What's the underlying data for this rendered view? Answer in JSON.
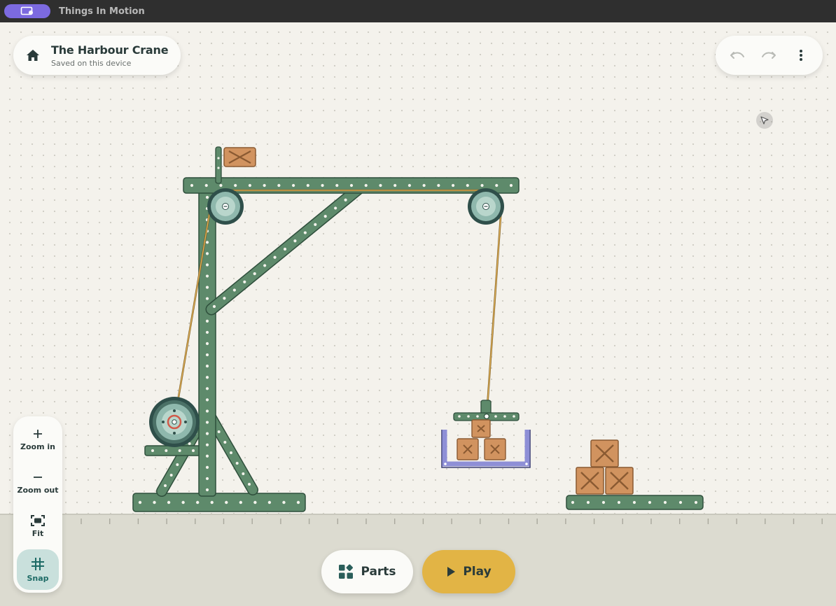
{
  "window": {
    "app_name": "Things In Motion"
  },
  "project": {
    "title": "The Harbour Crane",
    "save_status": "Saved on this device"
  },
  "toolbar": {
    "home_icon": "home-icon",
    "undo_icon": "undo-icon",
    "redo_icon": "redo-icon",
    "menu_icon": "more-vertical-icon"
  },
  "zoom_controls": {
    "zoom_in_label": "Zoom in",
    "zoom_out_label": "Zoom out",
    "fit_label": "Fit",
    "snap_label": "Snap",
    "snap_active": true
  },
  "bottom_bar": {
    "parts_label": "Parts",
    "play_label": "Play"
  },
  "colors": {
    "beam": "#5e8a6b",
    "beam_edge": "#2f4f3c",
    "crate": "#d1935f",
    "crate_edge": "#8a5a32",
    "rope": "#c99a3a",
    "basket": "#8e8fd6",
    "play": "#e2b445",
    "canvas": "#f4f2ec",
    "ground": "#dcdbd0"
  }
}
